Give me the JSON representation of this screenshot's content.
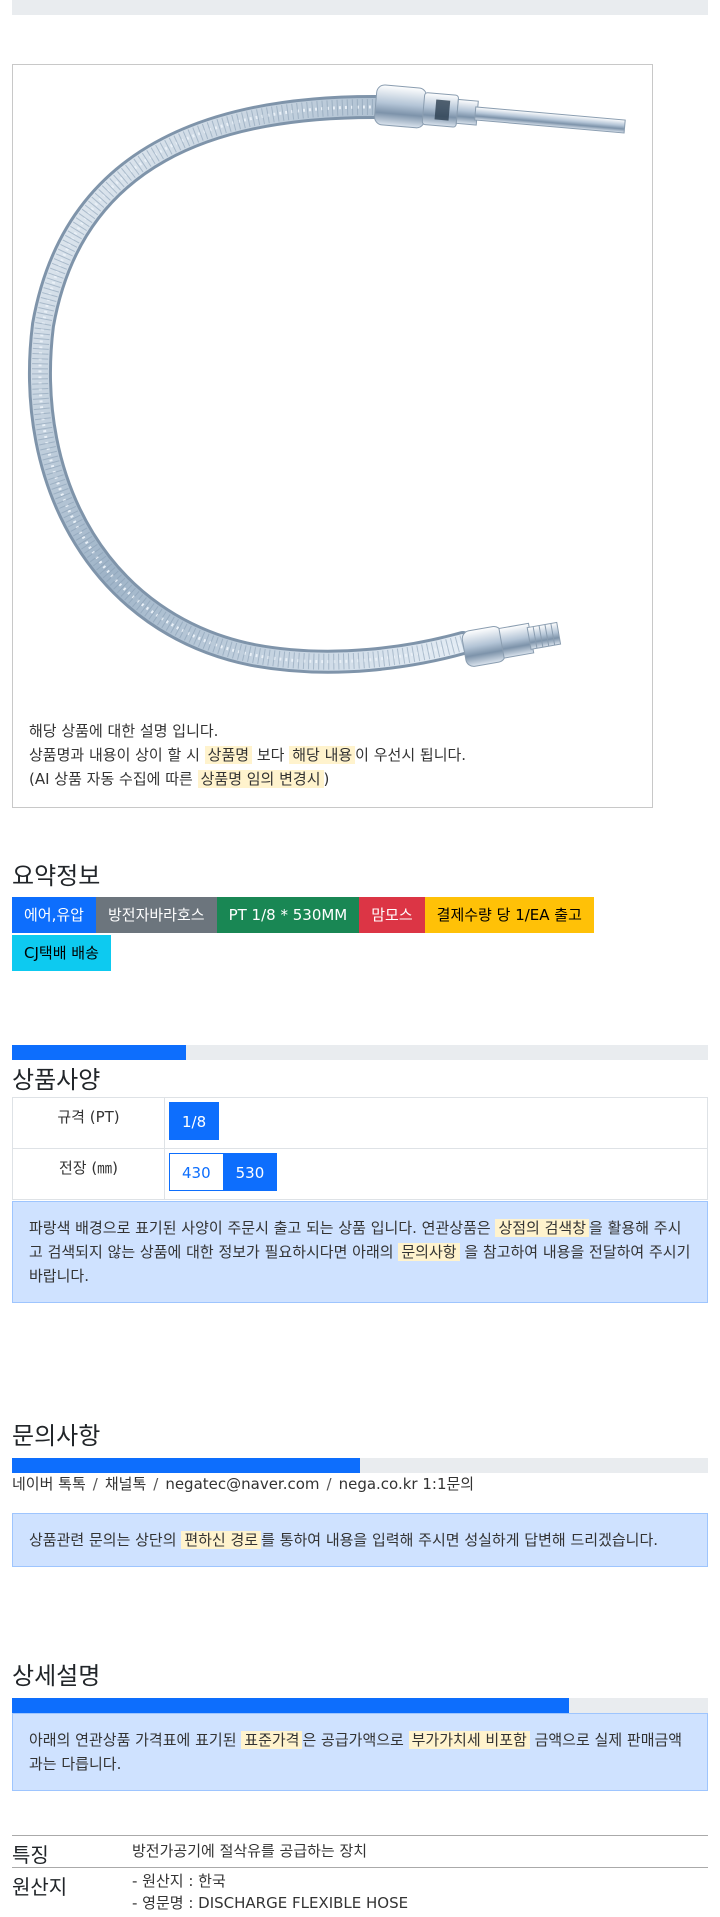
{
  "product": {
    "image_alt": "flexible discharge hose",
    "desc_line1": "해당 상품에 대한 설명 입니다.",
    "desc_line2_a": "상품명과 내용이 상이 할 시 ",
    "desc_line2_hl1": "상품명",
    "desc_line2_b": " 보다 ",
    "desc_line2_hl2": "해당 내용",
    "desc_line2_c": "이 우선시 됩니다.",
    "desc_line3_a": "(AI 상품 자동 수집에 따른 ",
    "desc_line3_hl": "상품명 임의 변경시",
    "desc_line3_b": ")"
  },
  "summary": {
    "title": "요약정보",
    "badges": [
      {
        "label": "에어,유압",
        "color": "#0d6efd",
        "text_color": "#ffffff"
      },
      {
        "label": "방전자바라호스",
        "color": "#6c757d",
        "text_color": "#ffffff"
      },
      {
        "label": "PT 1/8 * 530MM",
        "color": "#198754",
        "text_color": "#ffffff"
      },
      {
        "label": "맘모스",
        "color": "#dc3545",
        "text_color": "#ffffff"
      },
      {
        "label": "결제수량 당 1/EA 출고",
        "color": "#ffc107",
        "text_color": "#000000"
      },
      {
        "label": "CJ택배 배송",
        "color": "#0dcaf0",
        "text_color": "#000000"
      }
    ]
  },
  "spec": {
    "title": "상품사양",
    "progress": 0.25,
    "rows": [
      {
        "label": "규격 (PT)",
        "options": [
          {
            "label": "1/8",
            "active": true
          }
        ]
      },
      {
        "label": "전장 (㎜)",
        "options": [
          {
            "label": "430",
            "active": false
          },
          {
            "label": "530",
            "active": true
          }
        ]
      }
    ],
    "note_a": "파랑색 배경으로 표기된 사양이 주문시 출고 되는 상품 입니다. 연관상품은 ",
    "note_hl1": "상점의 검색창",
    "note_b": "을 활용해 주시고 검색되지 않는 상품에 대한 정보가 필요하시다면 아래의 ",
    "note_hl2": "문의사항",
    "note_c": " 을 참고하여 내용을 전달하여 주시기 바랍니다."
  },
  "inquiry": {
    "title": "문의사항",
    "progress": 0.5,
    "contacts": [
      "네이버 톡톡",
      "채널톡",
      "negatec@naver.com",
      "nega.co.kr 1:1문의"
    ],
    "separator": "/",
    "note_a": "상품관련 문의는 상단의 ",
    "note_hl": "편하신 경로",
    "note_b": "를 통하여 내용을 입력해 주시면 성실하게 답변해 드리겠습니다."
  },
  "detail": {
    "title": "상세설명",
    "progress": 0.8,
    "note_a": "아래의 연관상품 가격표에 표기된 ",
    "note_hl1": "표준가격",
    "note_b": "은 공급가액으로 ",
    "note_hl2": "부가가치세 비포함",
    "note_c": " 금액으로 실제 판매금액과는 다릅니다.",
    "features": [
      {
        "key": "특징",
        "lines": [
          "방전가공기에 절삭유를 공급하는 장치"
        ]
      },
      {
        "key": "원산지",
        "lines": [
          "- 원산지 : 한국",
          "- 영문명 : DISCHARGE FLEXIBLE HOSE"
        ]
      }
    ]
  }
}
